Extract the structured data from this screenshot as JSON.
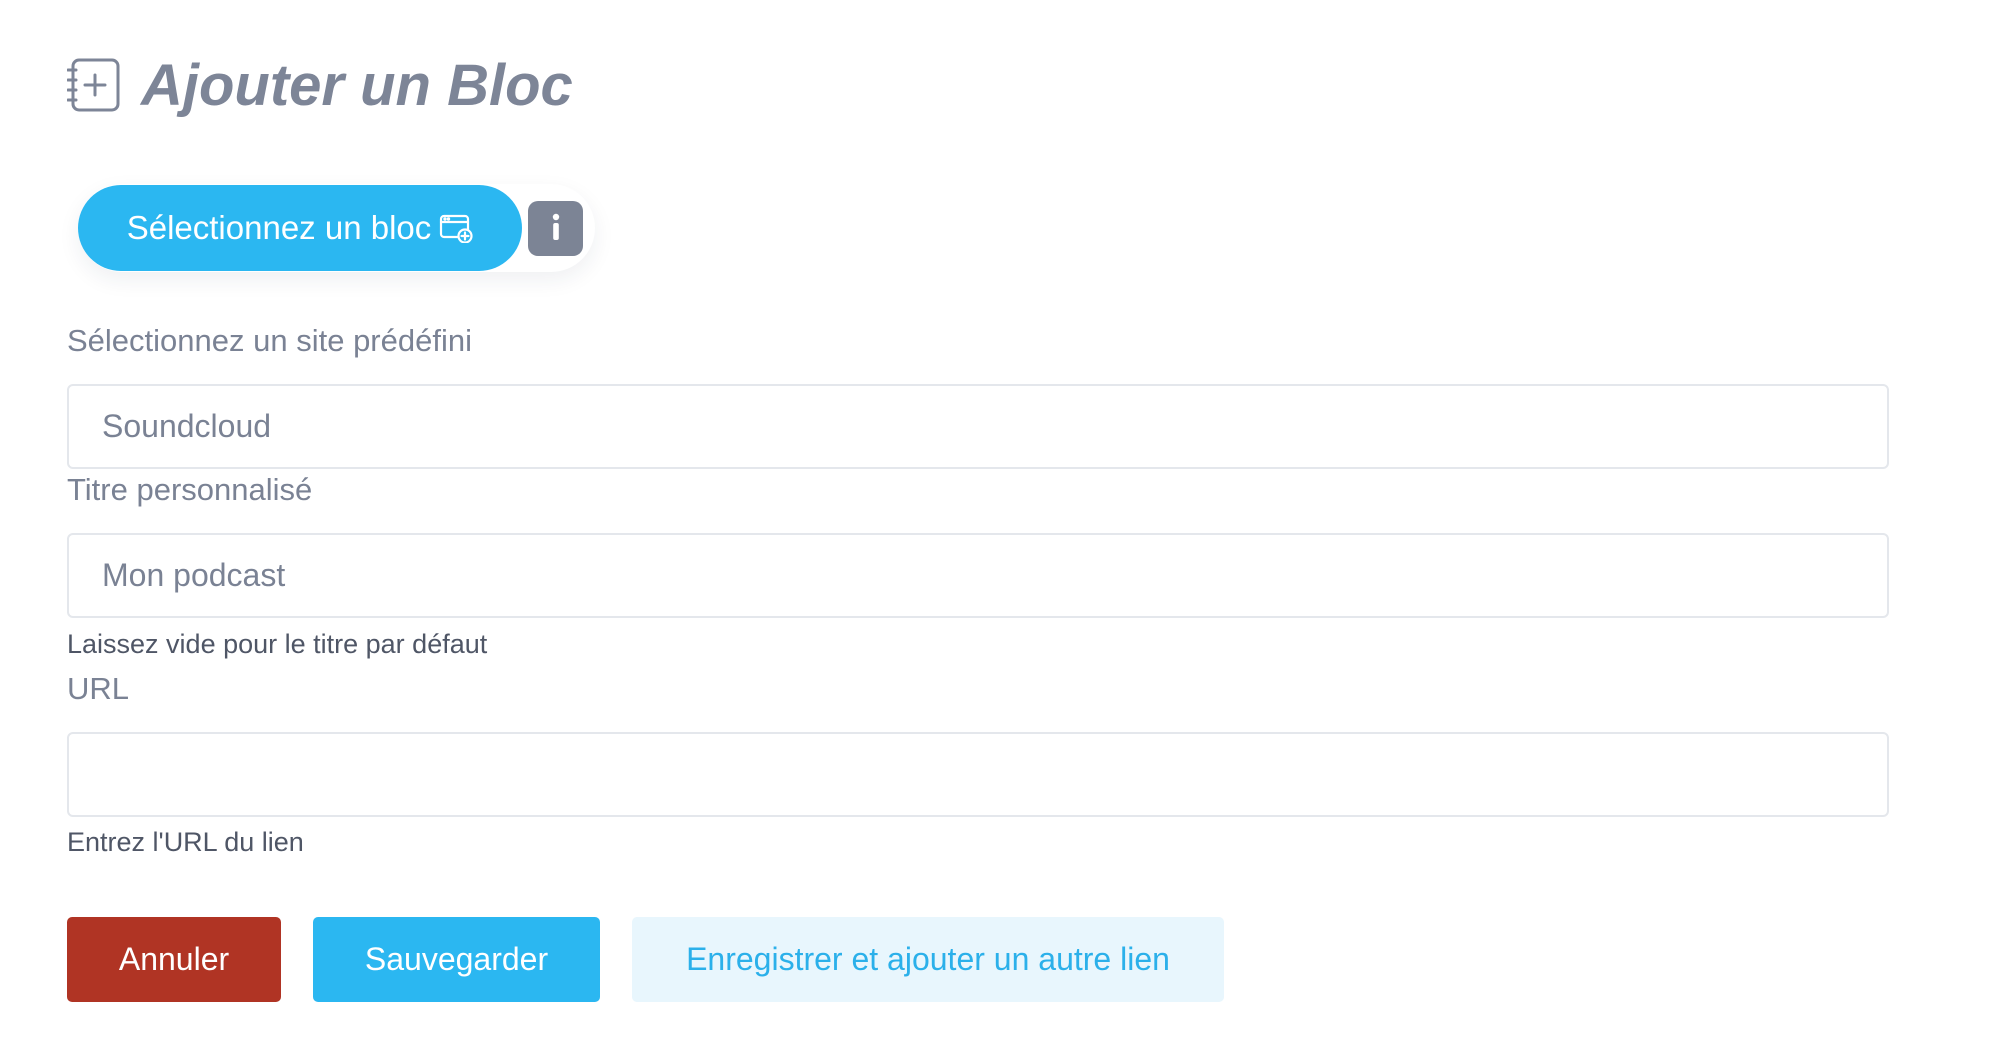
{
  "header": {
    "title": "Ajouter un Bloc",
    "icon": "add-block-icon"
  },
  "block_selector": {
    "button_label": "Sélectionnez un bloc",
    "button_icon": "browser-add-icon",
    "info_icon": "info-icon"
  },
  "form": {
    "predefined_site": {
      "label": "Sélectionnez un site prédéfini",
      "value": "Soundcloud"
    },
    "custom_title": {
      "label": "Titre personnalisé",
      "placeholder": "Mon podcast",
      "help": "Laissez vide pour le titre par défaut"
    },
    "url": {
      "label": "URL",
      "value": "",
      "help": "Entrez l'URL du lien"
    }
  },
  "actions": {
    "cancel_label": "Annuler",
    "save_label": "Sauvegarder",
    "save_another_label": "Enregistrer et ajouter un autre lien"
  },
  "colors": {
    "primary": "#2bb7f1",
    "danger": "#b03424",
    "secondary_bg": "#e8f6fd",
    "text_muted": "#7a8294",
    "info_bg": "#7c8495"
  }
}
